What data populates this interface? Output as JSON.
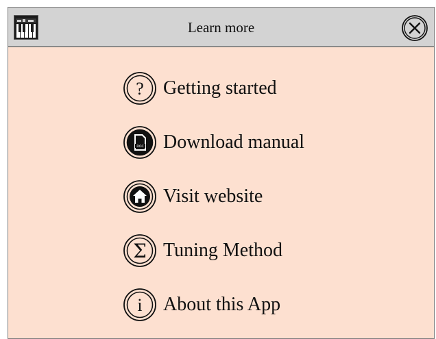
{
  "dialog": {
    "title": "Learn more",
    "app_icon": "piano-keys-icon",
    "close_icon": "close-circle-icon"
  },
  "menu": {
    "items": [
      {
        "label": "Getting started",
        "icon": "question-icon"
      },
      {
        "label": "Download manual",
        "icon": "doc-icon"
      },
      {
        "label": "Visit website",
        "icon": "home-icon"
      },
      {
        "label": "Tuning Method",
        "icon": "sigma-icon"
      },
      {
        "label": "About this App",
        "icon": "info-icon"
      }
    ]
  },
  "colors": {
    "background": "#fde0d0",
    "titlebar": "#d3d3d3",
    "ink": "#111111"
  }
}
